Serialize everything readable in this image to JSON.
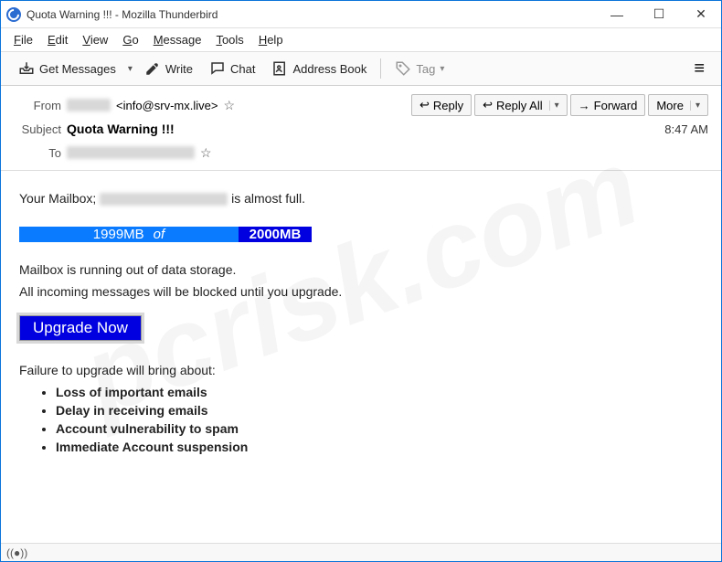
{
  "window": {
    "title": "Quota Warning !!! - Mozilla Thunderbird"
  },
  "menubar": {
    "file": "File",
    "edit": "Edit",
    "view": "View",
    "go": "Go",
    "message": "Message",
    "tools": "Tools",
    "help": "Help"
  },
  "toolbar": {
    "get_messages": "Get Messages",
    "write": "Write",
    "chat": "Chat",
    "address_book": "Address Book",
    "tag": "Tag"
  },
  "header": {
    "from_label": "From",
    "from_email": "<info@srv-mx.live>",
    "subject_label": "Subject",
    "subject": "Quota Warning !!!",
    "to_label": "To",
    "time": "8:47 AM",
    "reply": "Reply",
    "reply_all": "Reply All",
    "forward": "Forward",
    "more": "More"
  },
  "body": {
    "intro_prefix": "Your Mailbox; ",
    "intro_suffix": " is almost full.",
    "used": "1999MB",
    "of": "of",
    "total": "2000MB",
    "line1": "Mailbox is running out of data storage.",
    "line2": "All incoming messages will be blocked until you upgrade.",
    "upgrade": "Upgrade Now",
    "failure_heading": "Failure to upgrade will bring about:",
    "failures": [
      "Loss of important emails",
      "Delay in receiving emails",
      "Account vulnerability to spam",
      "Immediate Account suspension"
    ]
  },
  "status": {
    "icon": "((●))"
  }
}
